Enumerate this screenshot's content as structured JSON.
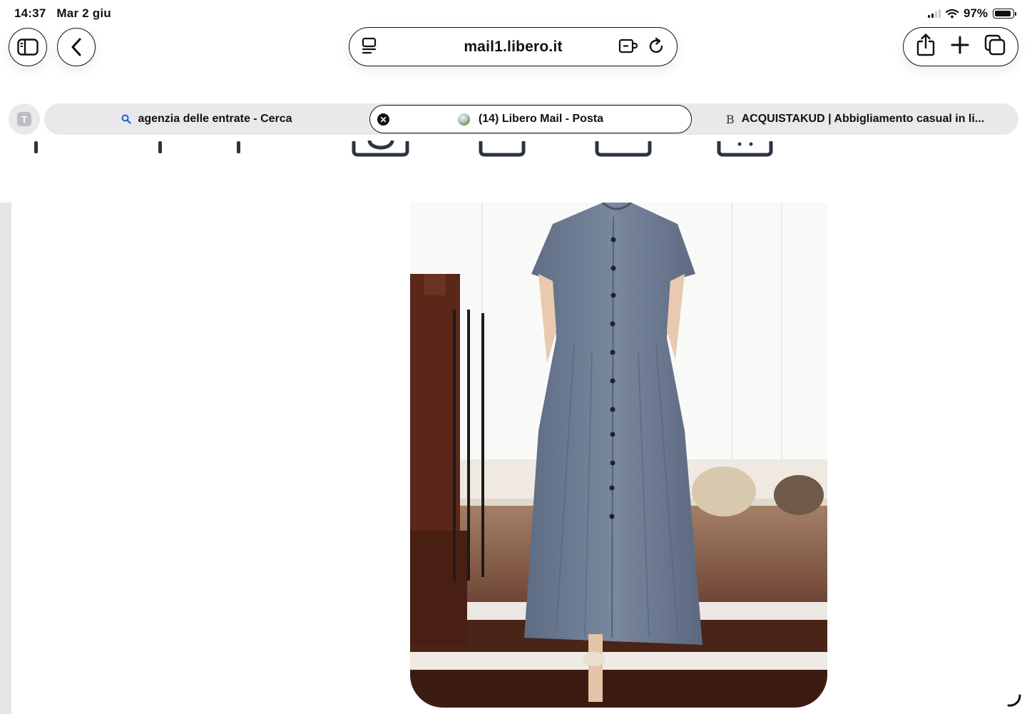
{
  "status_bar": {
    "time": "14:37",
    "date": "Mar 2 giu",
    "battery_percent": "97%",
    "signal_icon": "cellular-signal-icon",
    "wifi_icon": "wifi-icon",
    "battery_icon": "battery-icon",
    "battery_level": 0.97
  },
  "toolbar": {
    "sidebar_icon": "sidebar-icon",
    "back_icon": "chevron-left-icon",
    "url": "mail1.libero.it",
    "page_menu_icon": "page-menu-icon",
    "extension_icon": "extension-icon",
    "reload_icon": "reload-icon",
    "share_icon": "share-icon",
    "new_tab_icon": "plus-icon",
    "tabs_overview_icon": "tabs-icon"
  },
  "tab_group": {
    "label": "T"
  },
  "tabs": [
    {
      "title": "agenzia delle entrate - Cerca",
      "icon": "search-icon",
      "active": false
    },
    {
      "title": "(14) Libero Mail - Posta",
      "icon": "globe-favicon",
      "active": true
    },
    {
      "title": "ACQUISTAKUD | Abbigliamento casual in li...",
      "icon_text": "B",
      "active": false
    }
  ],
  "colors": {
    "accent_search": "#1a5fd0",
    "tabbar_bg": "#e9e9ec",
    "dress": "#6b7a92",
    "wall": "#f1efec",
    "floor": "#5a3222"
  }
}
